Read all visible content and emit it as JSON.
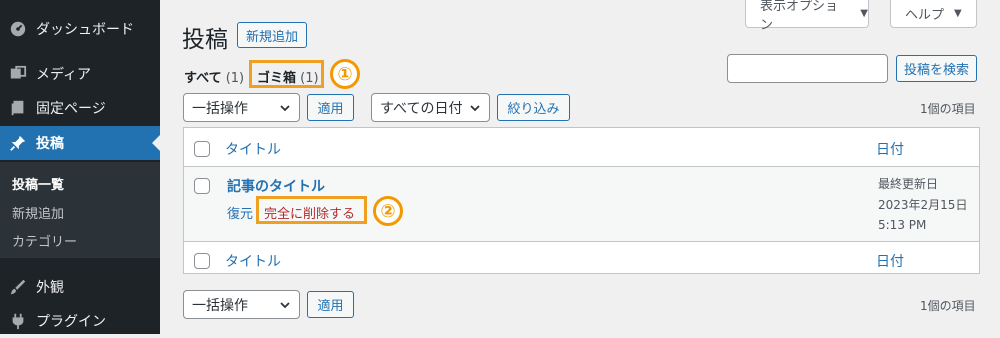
{
  "sidebar": {
    "items": [
      {
        "label": "ダッシュボード",
        "icon": "dashboard-icon"
      },
      {
        "label": "メディア",
        "icon": "media-icon"
      },
      {
        "label": "固定ページ",
        "icon": "pages-icon"
      },
      {
        "label": "投稿",
        "icon": "pin-icon"
      },
      {
        "label": "外観",
        "icon": "brush-icon"
      },
      {
        "label": "プラグイン",
        "icon": "plugin-icon"
      }
    ],
    "submenu": [
      "投稿一覧",
      "新規追加",
      "カテゴリー"
    ]
  },
  "header": {
    "title": "投稿",
    "add_new": "新規追加",
    "screen_options": "表示オプション",
    "help": "ヘルプ"
  },
  "views": {
    "all_label": "すべて",
    "all_count": "(1)",
    "trash_label": "ゴミ箱",
    "trash_count": "(1)"
  },
  "search": {
    "value": "",
    "button": "投稿を検索"
  },
  "filters": {
    "bulk_action": "一括操作",
    "apply": "適用",
    "dates": "すべての日付",
    "filter_button": "絞り込み",
    "items_count": "1個の項目"
  },
  "table": {
    "col_title": "タイトル",
    "col_date": "日付",
    "rows": [
      {
        "title": "記事のタイトル",
        "restore": "復元",
        "delete_permanently": "完全に削除する",
        "date_status": "最終更新日",
        "date": "2023年2月15日",
        "time": "5:13 PM"
      }
    ]
  },
  "annotations": {
    "one": "①",
    "two": "②"
  },
  "colors": {
    "sidebar_bg": "#1d2327",
    "accent": "#2271b1",
    "highlight": "#f39800",
    "danger": "#b32d2e"
  }
}
